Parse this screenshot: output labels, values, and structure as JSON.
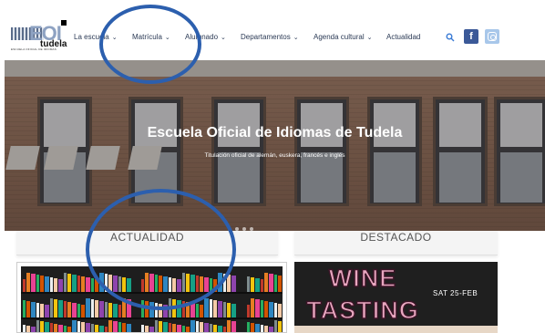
{
  "logo": {
    "mark": "EOI",
    "name": "tudela",
    "tagline": "ESCUELA OFICIAL DE IDIOMAS"
  },
  "nav": {
    "items": [
      {
        "label": "La escuela",
        "has_dropdown": true
      },
      {
        "label": "Matrícula",
        "has_dropdown": true
      },
      {
        "label": "Alumnado",
        "has_dropdown": true
      },
      {
        "label": "Departamentos",
        "has_dropdown": true
      },
      {
        "label": "Agenda cultural",
        "has_dropdown": true
      },
      {
        "label": "Actualidad",
        "has_dropdown": false
      }
    ],
    "search_icon": "search-icon",
    "social": [
      {
        "icon": "facebook-icon",
        "glyph": "f",
        "color": "#3b5998"
      },
      {
        "icon": "instagram-icon",
        "color": "#a8c7ea"
      }
    ]
  },
  "hero": {
    "title": "Escuela Oficial de Idiomas de Tudela",
    "subtitle": "Titulación oficial de alemán, euskera, francés e inglés"
  },
  "sections": {
    "left_tab": "ACTUALIDAD",
    "right_tab": "DESTACADO"
  },
  "featured": {
    "line1": "WINE",
    "line2": "TASTING",
    "date": "SAT 25-FEB"
  },
  "annotation_color": "#2c5fae"
}
